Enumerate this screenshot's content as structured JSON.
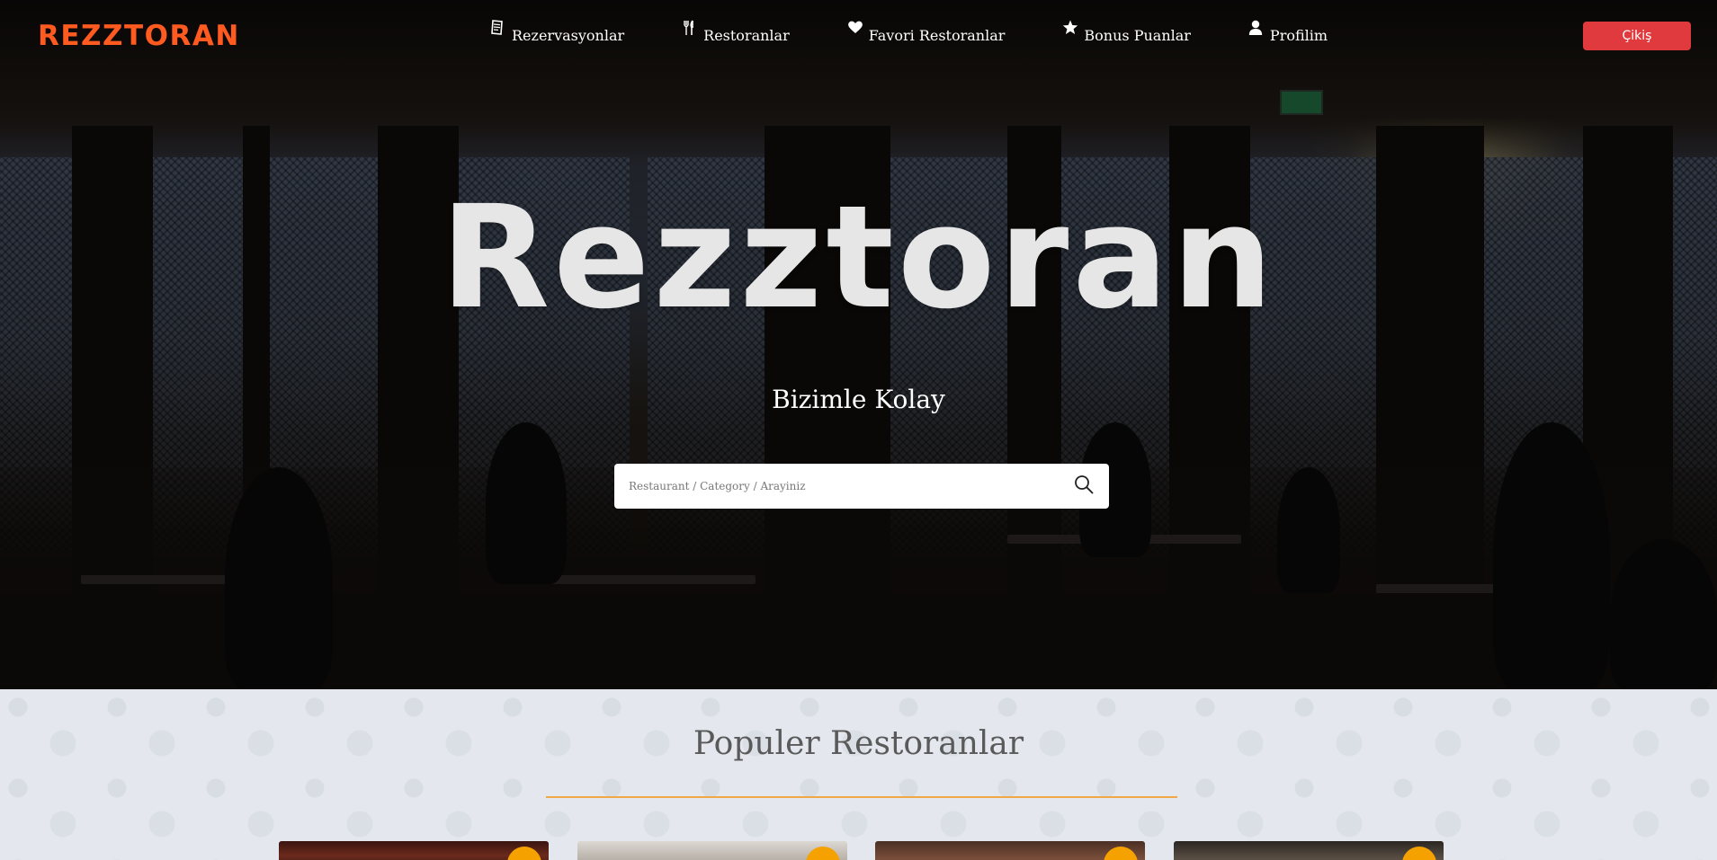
{
  "brand": {
    "logo": "REZZTORAN"
  },
  "nav": {
    "items": [
      {
        "label": "Rezervasyonlar",
        "icon": "reservation-book-icon"
      },
      {
        "label": "Restoranlar",
        "icon": "fork-knife-icon"
      },
      {
        "label": "Favori Restoranlar",
        "icon": "heart-icon"
      },
      {
        "label": "Bonus Puanlar",
        "icon": "star-icon"
      },
      {
        "label": "Profilim",
        "icon": "user-icon"
      }
    ],
    "logout_label": "Çikiş"
  },
  "hero": {
    "title": "Rezztoran",
    "subtitle": "Bizimle Kolay",
    "search_placeholder": "Restaurant / Category / Arayiniz",
    "search_icon": "search-icon"
  },
  "popular": {
    "title": "Populer Restoranlar",
    "cards": [
      {
        "badge_icon": "favorite-badge-icon"
      },
      {
        "badge_icon": "favorite-badge-icon"
      },
      {
        "badge_icon": "favorite-badge-icon"
      },
      {
        "badge_icon": "favorite-badge-icon"
      }
    ]
  },
  "colors": {
    "brand_orange": "#ff5a1f",
    "logout_red": "#e03a3e",
    "divider_orange": "#f0a845",
    "badge_orange": "#f5a100",
    "section_bg": "#e4e8ee"
  }
}
